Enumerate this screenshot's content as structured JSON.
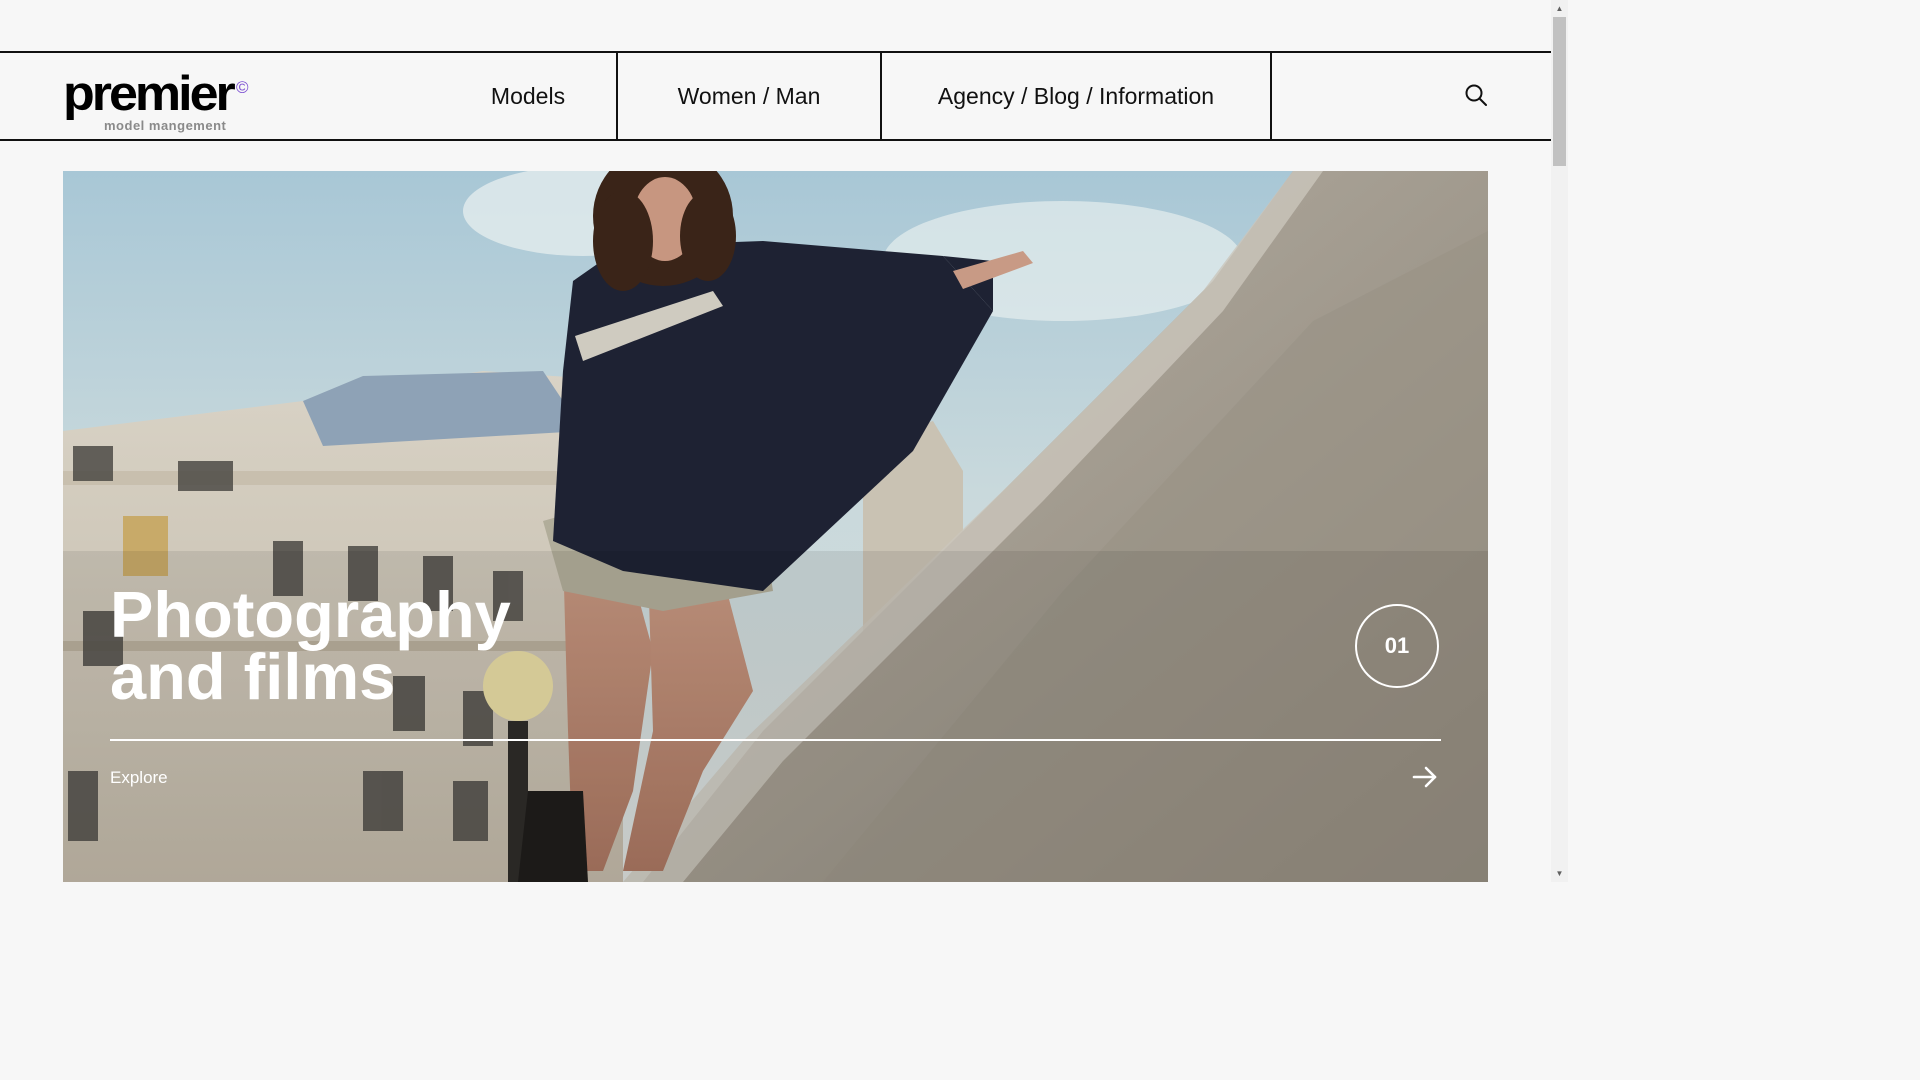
{
  "brand": {
    "name": "premier",
    "copyright_mark": "©",
    "tagline": "model mangement"
  },
  "nav": {
    "items": [
      {
        "label": "Models"
      },
      {
        "label": "Women / Man"
      },
      {
        "label": "Agency / Blog / Information"
      }
    ],
    "search_icon": "search-icon"
  },
  "hero": {
    "title": "Photography\nand films",
    "counter": "01",
    "cta_label": "Explore",
    "cta_icon": "arrow-right-icon"
  },
  "colors": {
    "text": "#111111",
    "accent": "#7a4dd1",
    "hero_text": "#ffffff"
  }
}
